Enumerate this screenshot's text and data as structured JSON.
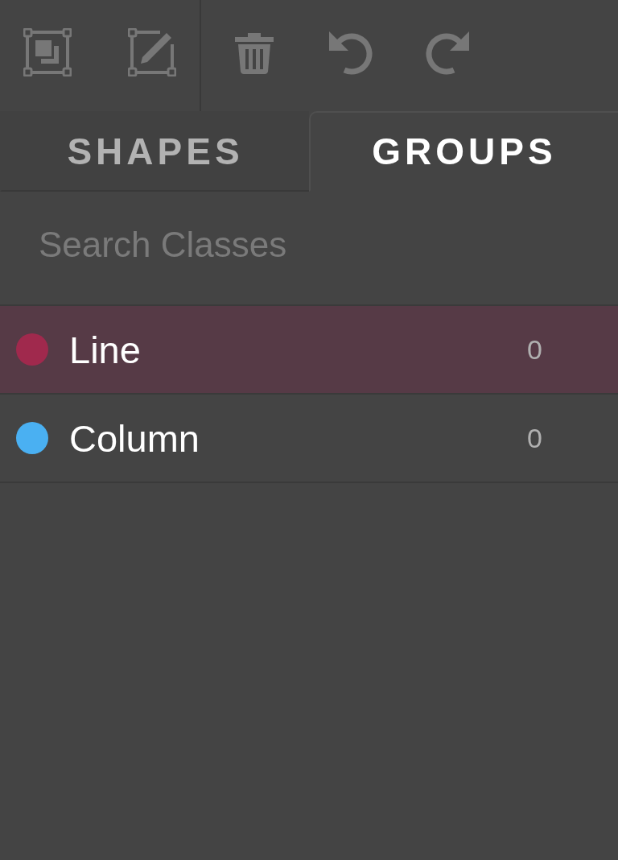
{
  "tabs": [
    {
      "label": "SHAPES",
      "selected": false
    },
    {
      "label": "GROUPS",
      "selected": true
    }
  ],
  "search": {
    "placeholder": "Search Classes"
  },
  "classes": [
    {
      "name": "Line",
      "count": "0",
      "color": "#a0294d",
      "selected": true
    },
    {
      "name": "Column",
      "count": "0",
      "color": "#4ab0f2",
      "selected": false
    }
  ]
}
